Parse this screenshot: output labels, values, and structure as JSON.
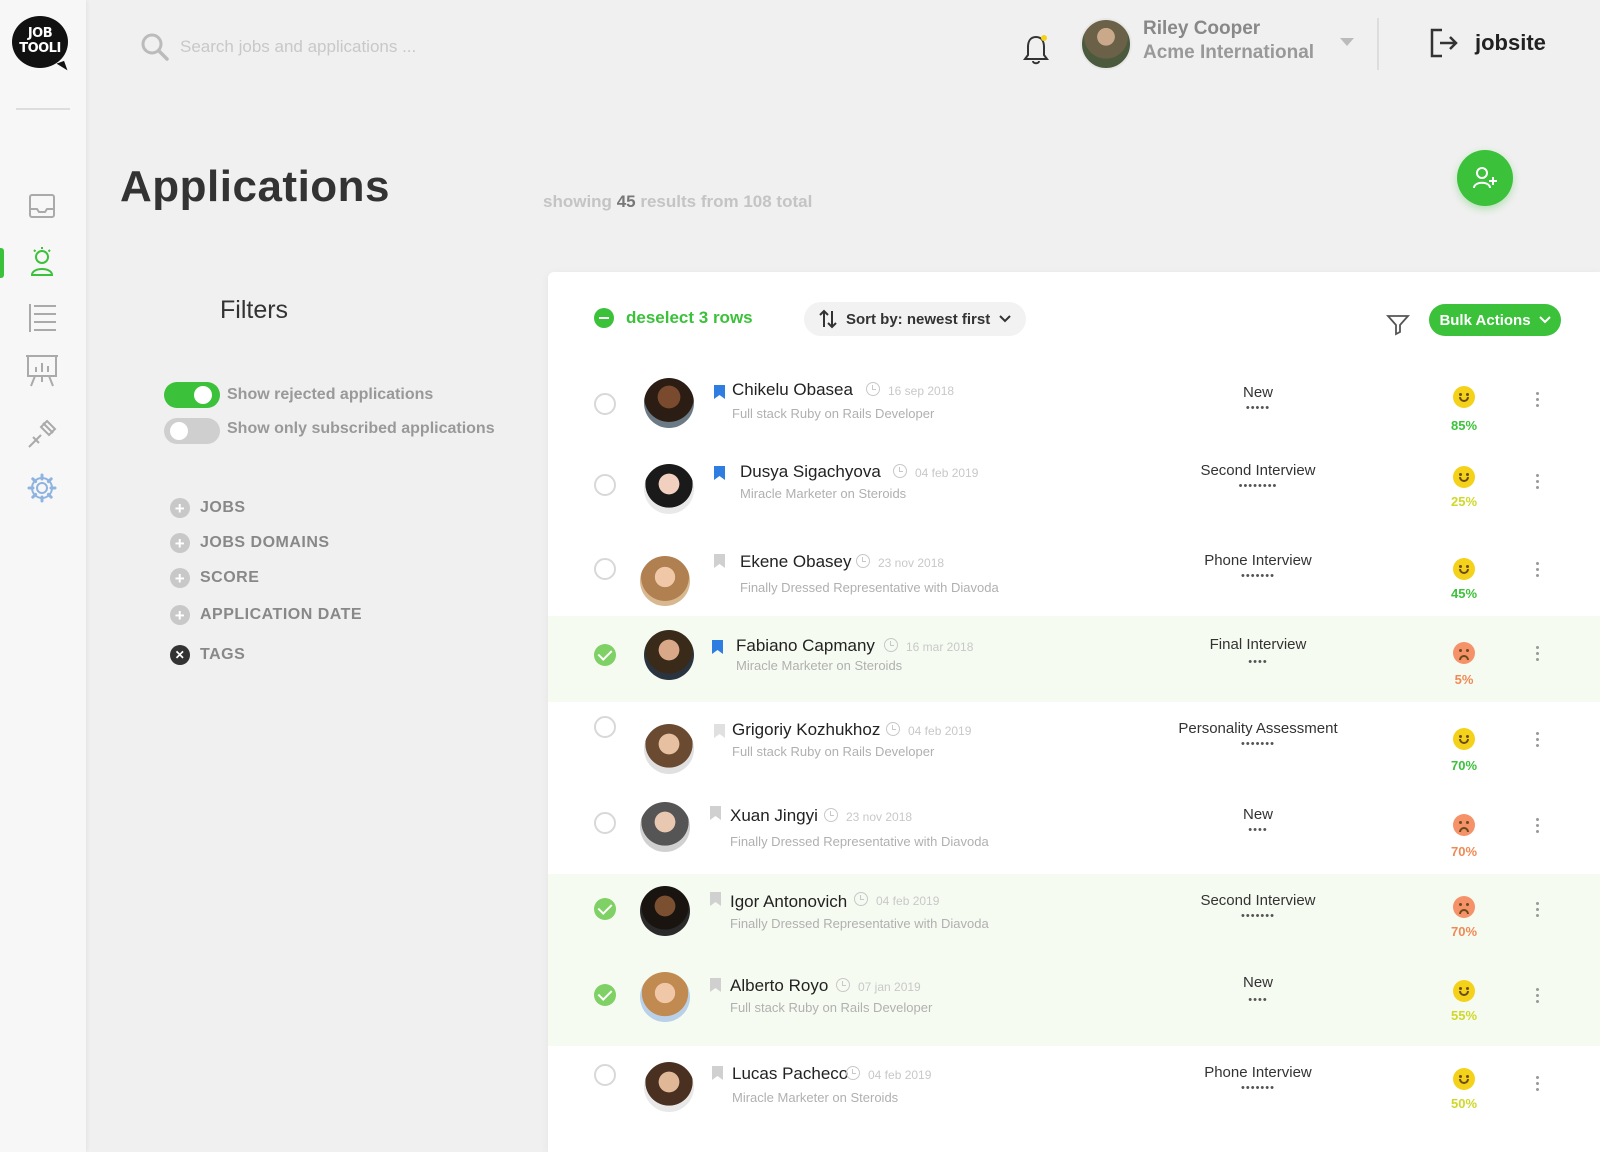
{
  "app": {
    "logo_line1": "JOB",
    "logo_line2": "TOOLI"
  },
  "search": {
    "placeholder": "Search jobs and applications ..."
  },
  "user": {
    "name": "Riley Cooper",
    "company": "Acme International"
  },
  "topbar": {
    "exit_label": "jobsite"
  },
  "page": {
    "title": "Applications",
    "results_prefix": "showing",
    "results_count": "45",
    "results_suffix": "results from 108 total"
  },
  "filters": {
    "title": "Filters",
    "toggles": [
      {
        "label": "Show rejected applications",
        "on": true
      },
      {
        "label": "Show only subscribed applications",
        "on": false
      }
    ],
    "categories": [
      {
        "label": "JOBS",
        "icon": "plus-circle-icon"
      },
      {
        "label": "JOBS DOMAINS",
        "icon": "plus-circle-icon"
      },
      {
        "label": "SCORE",
        "icon": "plus-circle-icon"
      },
      {
        "label": "APPLICATION DATE",
        "icon": "plus-circle-icon"
      },
      {
        "label": "TAGS",
        "icon": "x-circle-icon"
      }
    ]
  },
  "toolbar": {
    "deselect_label": "deselect 3 rows",
    "sort_label": "Sort by: newest first",
    "bulk_label": "Bulk Actions"
  },
  "colors": {
    "accent": "#3cc13b",
    "selected_row": "#f6fbf1",
    "happy": "#f5d21a",
    "sad": "#f5926a"
  },
  "applications": [
    {
      "name": "Chikelu Obasea",
      "date": "16 sep 2018",
      "role": "Full stack Ruby on Rails Developer",
      "stage": "New",
      "dots": "•••••",
      "score": "85%",
      "mood": "happy",
      "score_color": "green",
      "selected": false,
      "bookmarked": true
    },
    {
      "name": "Dusya Sigachyova",
      "date": "04 feb 2019",
      "role": "Miracle Marketer on Steroids",
      "stage": "Second Interview",
      "dots": "••••••••",
      "score": "25%",
      "mood": "happy",
      "score_color": "yellow",
      "selected": false,
      "bookmarked": true
    },
    {
      "name": "Ekene Obasey",
      "date": "23 nov 2018",
      "role": "Finally Dressed Representative with Diavoda",
      "stage": "Phone Interview",
      "dots": "•••••••",
      "score": "45%",
      "mood": "happy",
      "score_color": "green",
      "selected": false,
      "bookmarked": false
    },
    {
      "name": "Fabiano Capmany",
      "date": "16 mar 2018",
      "role": "Miracle Marketer on Steroids",
      "stage": "Final Interview",
      "dots": "••••",
      "score": "5%",
      "mood": "sad",
      "score_color": "orange",
      "selected": true,
      "bookmarked": true
    },
    {
      "name": "Grigoriy Kozhukhoz",
      "date": "04 feb 2019",
      "role": "Full stack Ruby on Rails Developer",
      "stage": "Personality Assessment",
      "dots": "•••••••",
      "score": "70%",
      "mood": "happy",
      "score_color": "green",
      "selected": false,
      "bookmarked": false
    },
    {
      "name": "Xuan Jingyi",
      "date": "23 nov 2018",
      "role": "Finally Dressed Representative with Diavoda",
      "stage": "New",
      "dots": "••••",
      "score": "70%",
      "mood": "sad",
      "score_color": "orange",
      "selected": false,
      "bookmarked": false
    },
    {
      "name": "Igor Antonovich",
      "date": "04 feb 2019",
      "role": "Finally Dressed Representative with Diavoda",
      "stage": "Second Interview",
      "dots": "•••••••",
      "score": "70%",
      "mood": "sad",
      "score_color": "orange",
      "selected": true,
      "bookmarked": false
    },
    {
      "name": "Alberto Royo",
      "date": "07 jan 2019",
      "role": "Full stack Ruby on Rails Developer",
      "stage": "New",
      "dots": "••••",
      "score": "55%",
      "mood": "happy",
      "score_color": "yellow",
      "selected": true,
      "bookmarked": false
    },
    {
      "name": "Lucas Pacheco",
      "date": "04 feb 2019",
      "role": "Miracle Marketer on Steroids",
      "stage": "Phone Interview",
      "dots": "•••••••",
      "score": "50%",
      "mood": "happy",
      "score_color": "yellow",
      "selected": false,
      "bookmarked": false
    }
  ]
}
